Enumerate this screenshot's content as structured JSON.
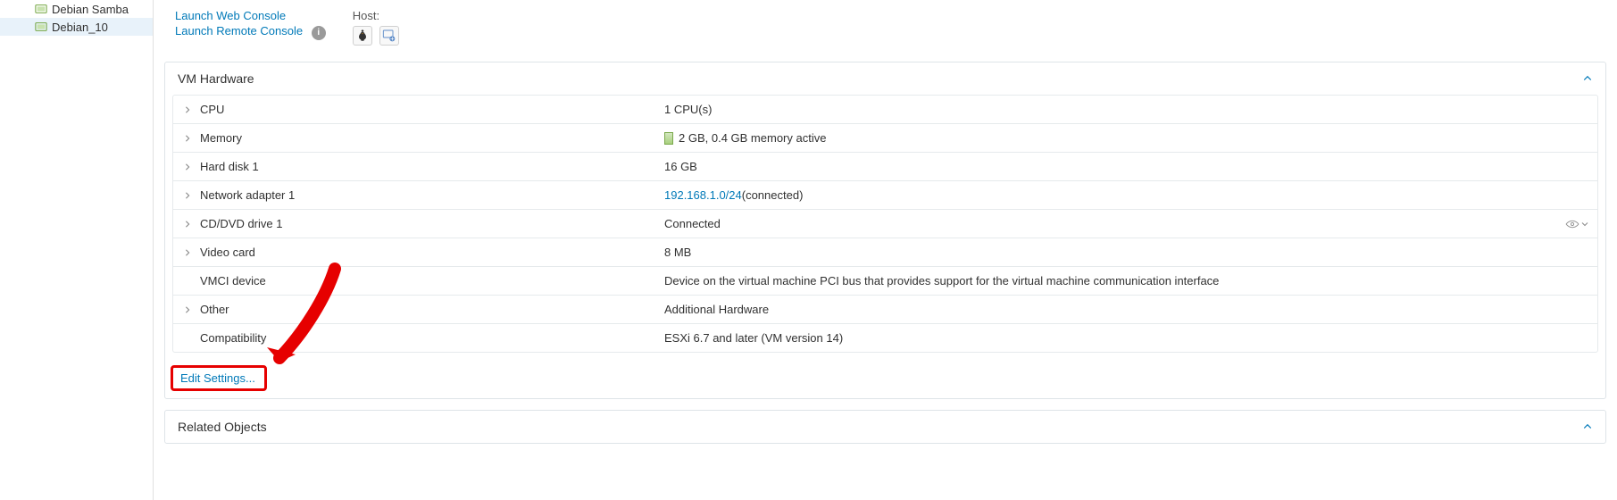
{
  "sidebar": {
    "items": [
      {
        "label": "Debian Samba"
      },
      {
        "label": "Debian_10"
      }
    ]
  },
  "console": {
    "launch_web": "Launch Web Console",
    "launch_remote": "Launch Remote Console"
  },
  "host": {
    "label": "Host:"
  },
  "panels": {
    "vm_hardware": {
      "title": "VM Hardware",
      "edit_settings": "Edit Settings...",
      "rows": {
        "cpu": {
          "label": "CPU",
          "value": "1 CPU(s)"
        },
        "memory": {
          "label": "Memory",
          "value": "2 GB, 0.4 GB memory active"
        },
        "disk1": {
          "label": "Hard disk 1",
          "value": "16 GB"
        },
        "net1": {
          "label": "Network adapter 1",
          "value_link": "192.168.1.0/24",
          "value_suffix": " (connected)"
        },
        "cd1": {
          "label": "CD/DVD drive 1",
          "value": "Connected"
        },
        "video": {
          "label": "Video card",
          "value": "8 MB"
        },
        "vmci": {
          "label": "VMCI device",
          "value": "Device on the virtual machine PCI bus that provides support for the virtual machine communication interface"
        },
        "other": {
          "label": "Other",
          "value": "Additional Hardware"
        },
        "compat": {
          "label": "Compatibility",
          "value": "ESXi 6.7 and later (VM version 14)"
        }
      }
    },
    "related_objects": {
      "title": "Related Objects"
    }
  }
}
